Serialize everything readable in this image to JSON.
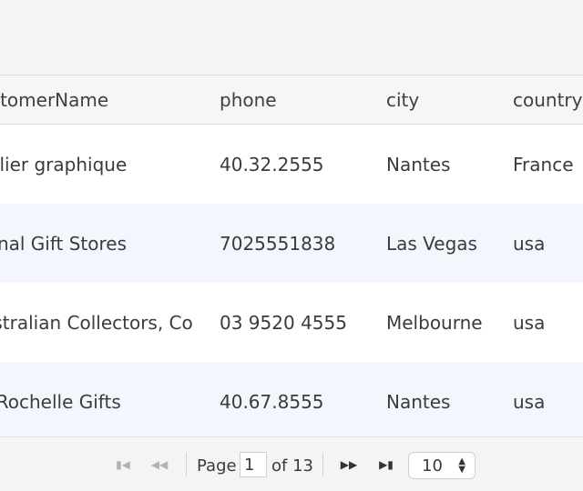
{
  "table": {
    "headers": [
      "customerName",
      "phone",
      "city",
      "country"
    ],
    "rows": [
      [
        "Atelier graphique",
        "40.32.2555",
        "Nantes",
        "France"
      ],
      [
        "Signal Gift Stores",
        "7025551838",
        "Las Vegas",
        "usa"
      ],
      [
        "Australian Collectors, Co",
        "03 9520 4555",
        "Melbourne",
        "usa"
      ],
      [
        "La Rochelle Gifts",
        "40.67.8555",
        "Nantes",
        "usa"
      ]
    ]
  },
  "pager": {
    "icons": {
      "first": "first-page-icon",
      "prev": "previous-page-icon",
      "next": "next-page-icon",
      "last": "last-page-icon",
      "select_arrows": "select-arrows-icon"
    },
    "glyphs": {
      "first": "▮◀",
      "prev": "◀◀",
      "next": "▶▶",
      "last": "▶▮",
      "up": "▲",
      "down": "▼"
    },
    "page_label": "Page",
    "current_page": "1",
    "of_label": "of 13",
    "page_size": "10"
  },
  "colors": {
    "row_odd": "#ffffff",
    "row_even": "#f3f7fd",
    "header_bg": "#f6f6f6",
    "text": "#3b3b3b",
    "disabled_icon": "#b3b3b3"
  }
}
